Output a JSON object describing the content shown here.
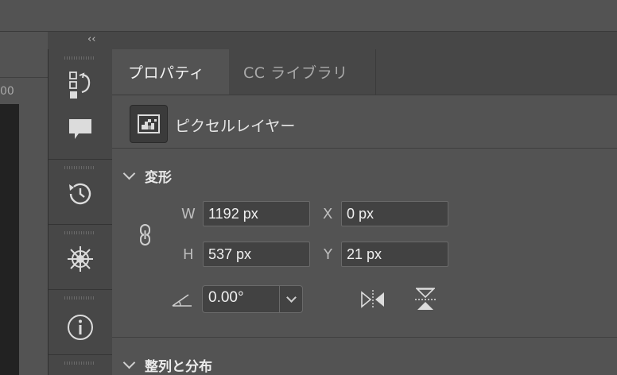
{
  "collapse": {
    "glyph": "‹‹"
  },
  "ruler": {
    "label": "00"
  },
  "dock": {
    "icons": [
      "layer-comps-icon",
      "comment-icon",
      "history-icon",
      "navigator-icon",
      "info-icon"
    ]
  },
  "tabs": [
    {
      "label": "プロパティ",
      "active": true
    },
    {
      "label": "CC ライブラリ",
      "active": false
    }
  ],
  "layer": {
    "type_label": "ピクセルレイヤー",
    "icon": "pixel-layer-icon"
  },
  "transform": {
    "title": "変形",
    "w_label": "W",
    "w_value": "1192 px",
    "h_label": "H",
    "h_value": "537 px",
    "x_label": "X",
    "x_value": "0 px",
    "y_label": "Y",
    "y_value": "21 px",
    "angle_value": "0.00°"
  },
  "align": {
    "title": "整列と分布"
  },
  "colors": {
    "panel": "#535353",
    "dock": "#474747",
    "field": "#424242",
    "text": "#e6e6e6"
  }
}
